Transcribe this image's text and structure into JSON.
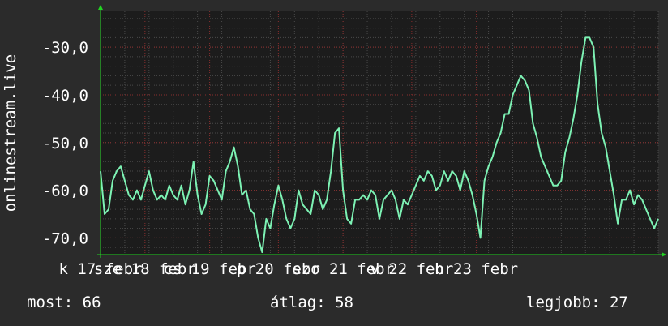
{
  "chart_data": {
    "type": "line",
    "ylabel": "onlinestream.live",
    "ylim": [
      -73.5,
      -22.5
    ],
    "yticks": [
      -70,
      -60,
      -50,
      -40,
      -30
    ],
    "ytick_labels": [
      "-70,0",
      "-60,0",
      "-50,0",
      "-40,0",
      "-30,0"
    ],
    "xlim": [
      0,
      138
    ],
    "xtick_labels": [
      "k 17 febr",
      "sze 18 febr",
      "cs 19 febr",
      "p 20 febr",
      "szo 21 febr",
      "v 22 febr",
      "h 23 febr"
    ],
    "xtick_positions": [
      0,
      11,
      27,
      44,
      60,
      77,
      93
    ],
    "grid": true,
    "colors": {
      "background": "#2b2b2b",
      "plot_background": "#1c1c1c",
      "line": "#7df2b4",
      "grid": "#4a4a4a",
      "accent_grid": "#8a2e2e",
      "axis_arrow": "#22d422"
    },
    "series": [
      {
        "values": [
          -56,
          -65,
          -64,
          -58,
          -56,
          -55,
          -58,
          -61,
          -62,
          -60,
          -62,
          -59,
          -56,
          -60,
          -62,
          -61,
          -62,
          -59,
          -61,
          -62,
          -59,
          -63,
          -60,
          -54,
          -61,
          -65,
          -63,
          -57,
          -58,
          -60,
          -62,
          -56,
          -54,
          -51,
          -55,
          -61,
          -60,
          -64,
          -65,
          -70,
          -73,
          -66,
          -68,
          -63,
          -59,
          -62,
          -66,
          -68,
          -66,
          -60,
          -63,
          -64,
          -65,
          -60,
          -61,
          -64,
          -62,
          -56,
          -48,
          -47,
          -60,
          -66,
          -67,
          -62,
          -62,
          -61,
          -62,
          -60,
          -61,
          -66,
          -62,
          -61,
          -60,
          -62,
          -66,
          -62,
          -63,
          -61,
          -59,
          -57,
          -58,
          -56,
          -57,
          -60,
          -59,
          -56,
          -58,
          -56,
          -57,
          -60,
          -56,
          -58,
          -61,
          -65,
          -70,
          -58,
          -55,
          -53,
          -50,
          -48,
          -44,
          -44,
          -40,
          -38,
          -36,
          -37,
          -39,
          -46,
          -49,
          -53,
          -55,
          -57,
          -59,
          -59,
          -58,
          -52,
          -49,
          -45,
          -40,
          -33,
          -28,
          -28,
          -30,
          -42,
          -48,
          -51,
          -56,
          -61,
          -67,
          -62,
          -62,
          -60,
          -63,
          -61,
          -62,
          -64,
          -66,
          -68,
          -66
        ]
      }
    ]
  },
  "stats": {
    "current": "most: 66",
    "average": "átlag: 58",
    "maximum": "legjobb: 27"
  }
}
